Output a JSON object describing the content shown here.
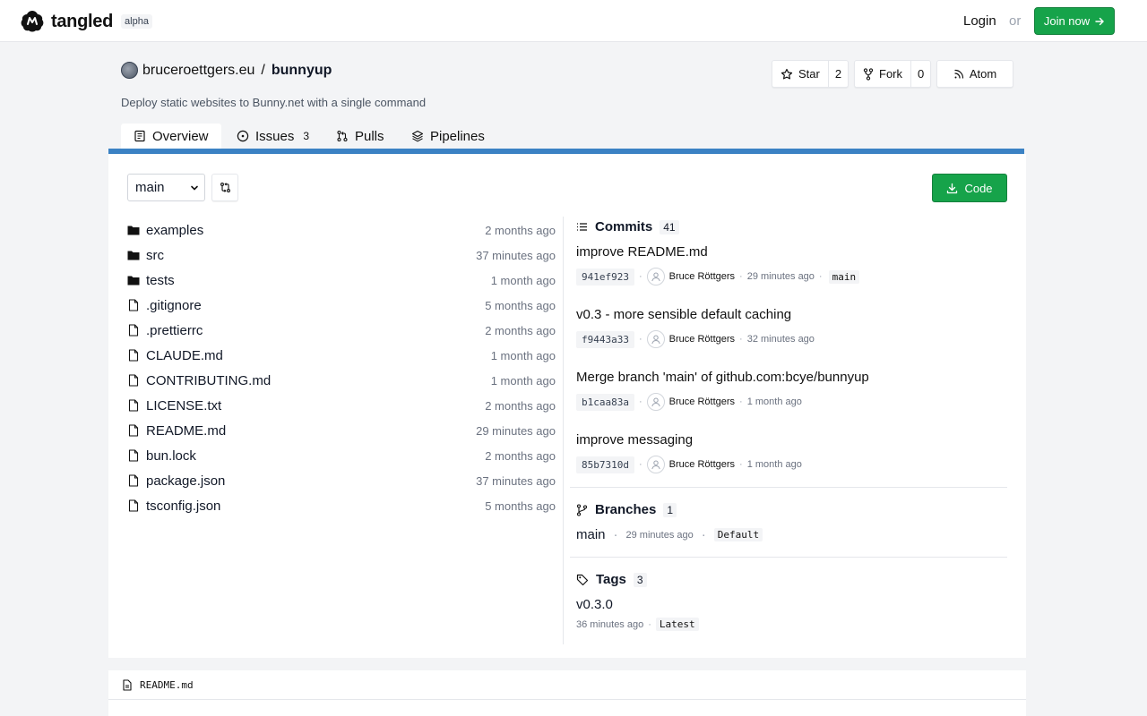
{
  "nav": {
    "brand": "tangled",
    "badge": "alpha",
    "login": "Login",
    "or": "or",
    "join": "Join now"
  },
  "repo": {
    "owner": "bruceroettgers.eu",
    "separator": "/",
    "name": "bunnyup",
    "description": "Deploy static websites to Bunny.net with a single command",
    "star_label": "Star",
    "star_count": "2",
    "fork_label": "Fork",
    "fork_count": "0",
    "atom_label": "Atom"
  },
  "tabs": [
    {
      "label": "Overview",
      "icon": "book-icon",
      "count": ""
    },
    {
      "label": "Issues",
      "icon": "circle-dot-icon",
      "count": "3"
    },
    {
      "label": "Pulls",
      "icon": "pull-request-icon",
      "count": ""
    },
    {
      "label": "Pipelines",
      "icon": "layers-icon",
      "count": ""
    }
  ],
  "toolbar": {
    "branch": "main",
    "code_label": "Code"
  },
  "files": [
    {
      "name": "examples",
      "type": "dir",
      "time": "2 months ago"
    },
    {
      "name": "src",
      "type": "dir",
      "time": "37 minutes ago"
    },
    {
      "name": "tests",
      "type": "dir",
      "time": "1 month ago"
    },
    {
      "name": ".gitignore",
      "type": "file",
      "time": "5 months ago"
    },
    {
      "name": ".prettierrc",
      "type": "file",
      "time": "2 months ago"
    },
    {
      "name": "CLAUDE.md",
      "type": "file",
      "time": "1 month ago"
    },
    {
      "name": "CONTRIBUTING.md",
      "type": "file",
      "time": "1 month ago"
    },
    {
      "name": "LICENSE.txt",
      "type": "file",
      "time": "2 months ago"
    },
    {
      "name": "README.md",
      "type": "file",
      "time": "29 minutes ago"
    },
    {
      "name": "bun.lock",
      "type": "file",
      "time": "2 months ago"
    },
    {
      "name": "package.json",
      "type": "file",
      "time": "37 minutes ago"
    },
    {
      "name": "tsconfig.json",
      "type": "file",
      "time": "5 months ago"
    }
  ],
  "commits": {
    "title": "Commits",
    "count": "41",
    "items": [
      {
        "message": "improve README.md",
        "sha": "941ef923",
        "author": "Bruce Röttgers",
        "time": "29 minutes ago",
        "ref": "main"
      },
      {
        "message": "v0.3 - more sensible default caching",
        "sha": "f9443a33",
        "author": "Bruce Röttgers",
        "time": "32 minutes ago",
        "ref": ""
      },
      {
        "message": "Merge branch 'main' of github.com:bcye/bunnyup",
        "sha": "b1caa83a",
        "author": "Bruce Röttgers",
        "time": "1 month ago",
        "ref": ""
      },
      {
        "message": "improve messaging",
        "sha": "85b7310d",
        "author": "Bruce Röttgers",
        "time": "1 month ago",
        "ref": ""
      }
    ]
  },
  "branches": {
    "title": "Branches",
    "count": "1",
    "name": "main",
    "time": "29 minutes ago",
    "label": "Default"
  },
  "tags": {
    "title": "Tags",
    "count": "3",
    "name": "v0.3.0",
    "time": "36 minutes ago",
    "label": "Latest"
  },
  "readme": {
    "filename": "README.md"
  },
  "colors": {
    "accent_green": "#16a34a",
    "tab_underline": "#3b82c4",
    "page_bg": "#f3f4f6"
  }
}
